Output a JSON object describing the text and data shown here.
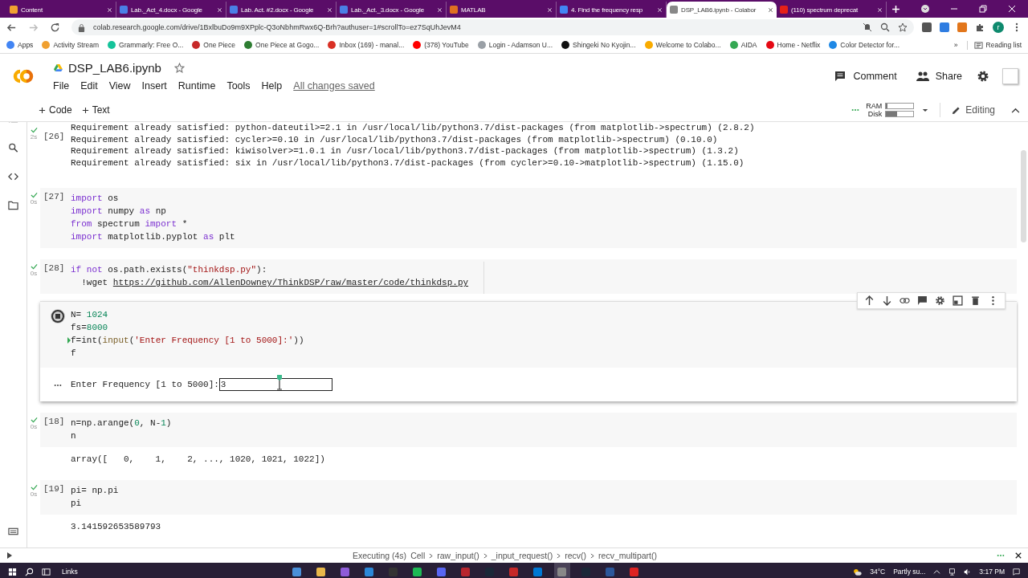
{
  "browser": {
    "tabs": [
      {
        "title": "Content",
        "selected": false
      },
      {
        "title": "Lab._Act_4.docx - Google",
        "selected": false
      },
      {
        "title": "Lab. Act. #2.docx - Google",
        "selected": false
      },
      {
        "title": "Lab._Act._3.docx - Google",
        "selected": false
      },
      {
        "title": "MATLAB",
        "selected": false
      },
      {
        "title": "4. Find the frequency resp",
        "selected": false
      },
      {
        "title": "DSP_LAB6.ipynb - Colabor",
        "selected": true
      },
      {
        "title": "(110) spectrum deprecat",
        "selected": false
      }
    ],
    "address": "colab.research.google.com/drive/1BxlbuDo9m9XPplc-Q3oNbhmRwx6Q-Brh?authuser=1#scrollTo=ez7SqUhJevM4",
    "avatar": "r",
    "bookmarks": [
      "Apps",
      "Activity Stream",
      "Grammarly: Free O...",
      "One Piece",
      "One Piece at Gogo...",
      "Inbox (169) - manal...",
      "(378) YouTube",
      "Login - Adamson U...",
      "Shingeki No Kyojin...",
      "Welcome to Colabo...",
      "AIDA",
      "Home - Netflix",
      "Color Detector for..."
    ],
    "more_bookmarks": "»",
    "reading_list": "Reading list"
  },
  "colab": {
    "title": "DSP_LAB6.ipynb",
    "menu": [
      "File",
      "Edit",
      "View",
      "Insert",
      "Runtime",
      "Tools",
      "Help"
    ],
    "saved": "All changes saved",
    "actions": [
      "Comment",
      "Share"
    ],
    "toolbar": {
      "add": [
        "Code",
        "Text"
      ],
      "ram_label": "RAM",
      "disk_label": "Disk",
      "ram": {
        "level": 0.05
      },
      "disk": {
        "level": 0.4
      },
      "mode": "Editing"
    }
  },
  "cells": [
    {
      "kind": "done",
      "number": "[26]",
      "time": "2s",
      "output": [
        "Requirement already satisfied: python-dateutil>=2.1 in /usr/local/lib/python3.7/dist-packages (from matplotlib->spectrum) (2.8.2)",
        "Requirement already satisfied: cycler>=0.10 in /usr/local/lib/python3.7/dist-packages (from matplotlib->spectrum) (0.10.0)",
        "Requirement already satisfied: kiwisolver>=1.0.1 in /usr/local/lib/python3.7/dist-packages (from matplotlib->spectrum) (1.3.2)",
        "Requirement already satisfied: six in /usr/local/lib/python3.7/dist-packages (from cycler>=0.10->matplotlib->spectrum) (1.15.0)"
      ]
    },
    {
      "kind": "done",
      "number": "[27]",
      "time": "0s",
      "lines": [
        {
          "tokens": [
            {
              "text": "import",
              "kind": "kw"
            },
            {
              "text": " os",
              "kind": "plain"
            }
          ]
        },
        {
          "tokens": [
            {
              "text": "import",
              "kind": "kw"
            },
            {
              "text": " numpy ",
              "kind": "plain"
            },
            {
              "text": "as",
              "kind": "kw"
            },
            {
              "text": " np",
              "kind": "plain"
            }
          ]
        },
        {
          "tokens": [
            {
              "text": "from",
              "kind": "kw"
            },
            {
              "text": " spectrum ",
              "kind": "plain"
            },
            {
              "text": "import",
              "kind": "kw"
            },
            {
              "text": " *",
              "kind": "plain"
            }
          ]
        },
        {
          "tokens": [
            {
              "text": "import",
              "kind": "kw"
            },
            {
              "text": " matplotlib.pyplot ",
              "kind": "plain"
            },
            {
              "text": "as",
              "kind": "kw"
            },
            {
              "text": " plt",
              "kind": "plain"
            }
          ]
        }
      ]
    },
    {
      "kind": "done",
      "number": "[28]",
      "time": "0s",
      "lines": [
        {
          "tokens": [
            {
              "text": "if",
              "kind": "kw"
            },
            {
              "text": " not",
              "kind": "kw"
            },
            {
              "text": " os.path.exists(",
              "kind": "plain"
            },
            {
              "text": "\"thinkdsp.py\"",
              "kind": "str"
            },
            {
              "text": "):",
              "kind": "plain"
            }
          ]
        },
        {
          "tokens": [
            {
              "text": "  !wget ",
              "kind": "plain"
            },
            {
              "text": "https://github.com/AllenDowney/ThinkDSP/raw/master/code/thinkdsp.py",
              "kind": "link"
            }
          ]
        }
      ]
    },
    {
      "kind": "running",
      "lines": [
        {
          "current": false,
          "tokens": [
            {
              "text": "N= ",
              "kind": "plain"
            },
            {
              "text": "1024",
              "kind": "num"
            }
          ]
        },
        {
          "current": false,
          "tokens": [
            {
              "text": "fs=",
              "kind": "plain"
            },
            {
              "text": "8000",
              "kind": "num"
            }
          ]
        },
        {
          "current": true,
          "tokens": [
            {
              "text": "f=int(",
              "kind": "plain"
            },
            {
              "text": "input",
              "kind": "fn"
            },
            {
              "text": "(",
              "kind": "plain"
            },
            {
              "text": "'Enter Frequency [1 to 5000]:'",
              "kind": "str"
            },
            {
              "text": "))",
              "kind": "plain"
            }
          ]
        },
        {
          "current": false,
          "tokens": [
            {
              "text": "f",
              "kind": "plain"
            }
          ]
        }
      ],
      "prompt": "Enter Frequency [1 to 5000]:",
      "value": "3"
    },
    {
      "kind": "done",
      "number": "[18]",
      "time": "0s",
      "lines": [
        {
          "tokens": [
            {
              "text": "n=np.arange(",
              "kind": "plain"
            },
            {
              "text": "0",
              "kind": "num"
            },
            {
              "text": ", N-",
              "kind": "plain"
            },
            {
              "text": "1",
              "kind": "num"
            },
            {
              "text": ")",
              "kind": "plain"
            }
          ]
        },
        {
          "tokens": [
            {
              "text": "n",
              "kind": "plain"
            }
          ]
        }
      ],
      "output": [
        "array([   0,    1,    2, ..., 1020, 1021, 1022])"
      ]
    },
    {
      "kind": "done",
      "number": "[19]",
      "time": "0s",
      "lines": [
        {
          "tokens": [
            {
              "text": "pi= np.pi",
              "kind": "plain"
            }
          ]
        },
        {
          "tokens": [
            {
              "text": "pi",
              "kind": "plain"
            }
          ]
        }
      ],
      "output": [
        "3.141592653589793"
      ]
    }
  ],
  "status": {
    "state": "Executing (4s)",
    "path": [
      "Cell",
      "raw_input()",
      "_input_request()",
      "recv()",
      "recv_multipart()"
    ]
  },
  "taskbar": {
    "links": "Links",
    "temperature": "34°C",
    "weather": "Partly su...",
    "time": "3:17 PM"
  }
}
